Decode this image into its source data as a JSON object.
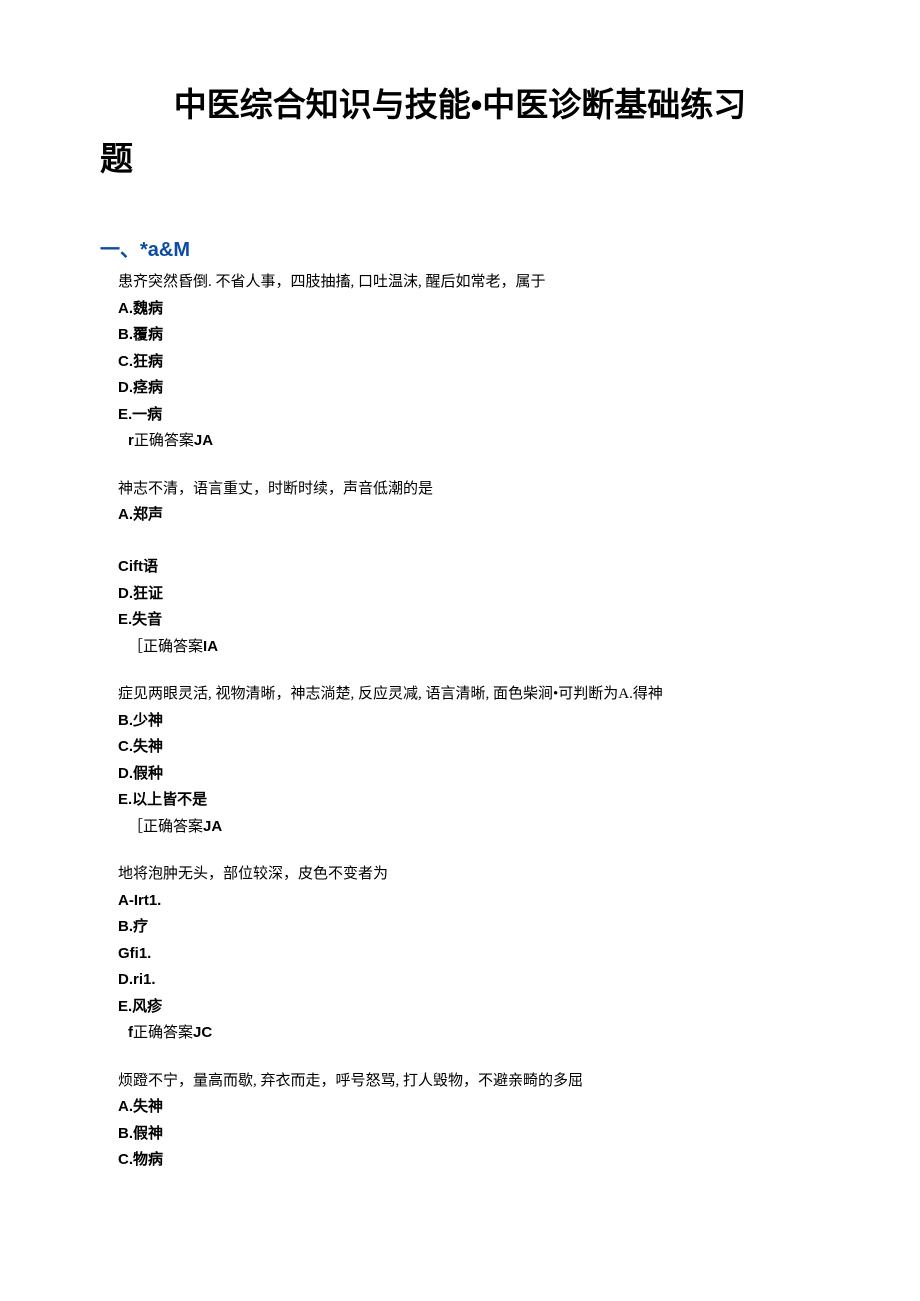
{
  "title_line1": "中医综合知识与技能•中医诊断基础练习",
  "title_line2": "题",
  "section_header": "一、*a&M",
  "questions": [
    {
      "stem": "患齐突然昏倒. 不省人事，四肢抽搐, 口吐温沫, 醒后如常老，属于",
      "options": [
        "A.魏病",
        "B.覆病",
        "C.狂病",
        "D.痉病",
        "E.一病"
      ],
      "answer_prefix": "r",
      "answer_mid": "正确答案",
      "answer_suffix": "JA"
    },
    {
      "stem": "神志不清，语言重丈，时断时续，声音低潮的是",
      "options": [
        "A.郑声",
        "",
        "Cift语",
        "D.狂证",
        "E.失音"
      ],
      "answer_prefix": "［",
      "answer_mid": "正确答案",
      "answer_suffix": "IA"
    },
    {
      "stem": "症见两眼灵活, 视物清晰，神志淌楚, 反应灵减, 语言清晰, 面色柴涧•可判断为A.得神",
      "options": [
        "B.少神",
        "C.失神",
        "D.假种",
        "E.以上皆不是"
      ],
      "answer_prefix": "［",
      "answer_mid": "正确答案",
      "answer_suffix": "JA"
    },
    {
      "stem": "地将泡肿无头，部位较深，皮色不变者为",
      "options": [
        "A-Irt1.",
        "B.疗",
        "Gfi1.",
        "D.ri1.",
        "E.风疹"
      ],
      "answer_prefix": "f",
      "answer_mid": "正确答案",
      "answer_suffix": "JC"
    },
    {
      "stem": "烦蹬不宁，量高而歇, 弃衣而走，呼号怒骂, 打人毁物，不避亲畸的多屈",
      "options": [
        "A.失神",
        "B.假神",
        "C.物病"
      ],
      "answer_prefix": "",
      "answer_mid": "",
      "answer_suffix": ""
    }
  ]
}
